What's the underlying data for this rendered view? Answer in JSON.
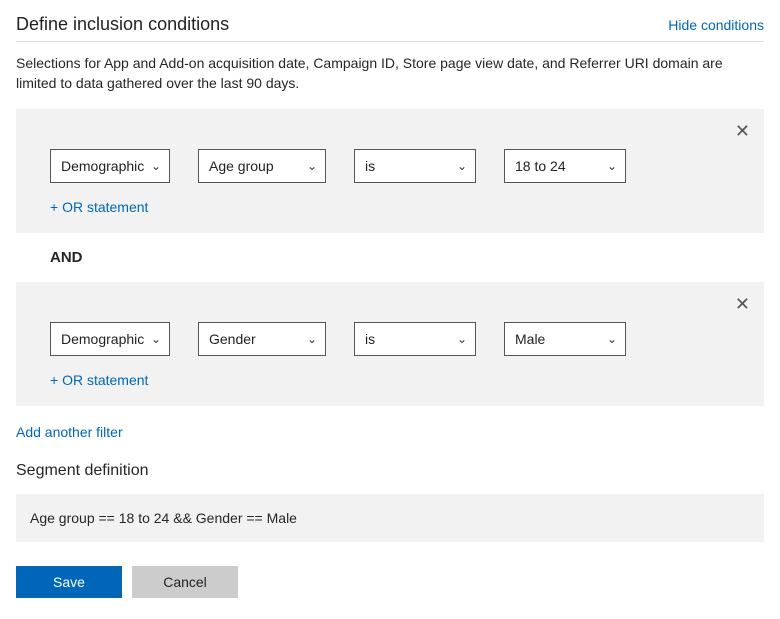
{
  "header": {
    "title": "Define inclusion conditions",
    "hide_link": "Hide conditions"
  },
  "description": "Selections for App and Add-on acquisition date, Campaign ID, Store page view date, and Referrer URI domain are limited to data gathered over the last 90 days.",
  "conditions": [
    {
      "category": "Demographic",
      "attribute": "Age group",
      "operator": "is",
      "value": "18 to 24",
      "or_label": "+ OR statement"
    },
    {
      "category": "Demographic",
      "attribute": "Gender",
      "operator": "is",
      "value": "Male",
      "or_label": "+ OR statement"
    }
  ],
  "and_label": "AND",
  "add_filter": "Add another filter",
  "segment": {
    "title": "Segment definition",
    "expression": "Age group == 18 to 24 && Gender == Male"
  },
  "buttons": {
    "save": "Save",
    "cancel": "Cancel"
  }
}
